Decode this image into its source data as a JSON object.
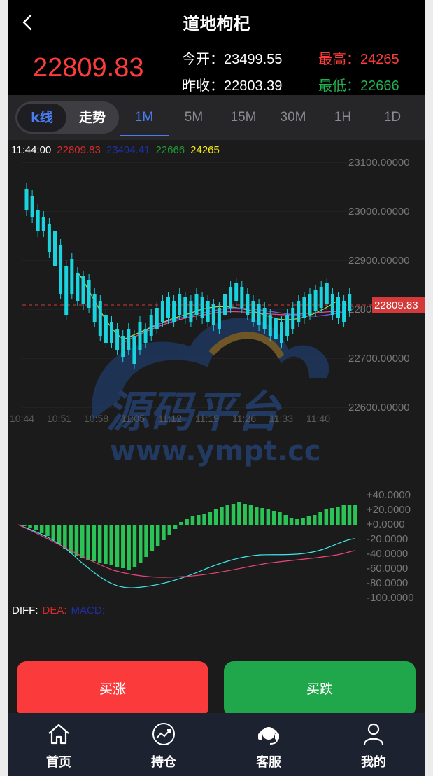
{
  "header": {
    "title": "道地枸杞",
    "current_price": "22809.83",
    "open_label": "今开：",
    "open_value": "23499.55",
    "prev_close_label": "昨收：",
    "prev_close_value": "22803.39",
    "high_label": "最高：",
    "high_value": "24265",
    "low_label": "最低：",
    "low_value": "22666"
  },
  "chart_type_tabs": [
    {
      "label": "k线",
      "active": true
    },
    {
      "label": "走势",
      "active": false
    }
  ],
  "timeframe_tabs": [
    {
      "label": "1M",
      "active": true
    },
    {
      "label": "5M",
      "active": false
    },
    {
      "label": "15M",
      "active": false
    },
    {
      "label": "30M",
      "active": false
    },
    {
      "label": "1H",
      "active": false
    },
    {
      "label": "1D",
      "active": false
    }
  ],
  "info_line": {
    "time": "11:44:00",
    "close": "22809.83",
    "open": "23494.41",
    "low": "22666",
    "high": "24265"
  },
  "price_axis_labels": [
    "23100.00000",
    "23000.00000",
    "22900.00000",
    "2280",
    "22700.00000",
    "22600.00000"
  ],
  "price_marker": "22809.83",
  "time_axis_labels": [
    "10:44",
    "10:51",
    "10:58",
    "11:05",
    "11:12",
    "11:19",
    "11:26",
    "11:33",
    "11:40"
  ],
  "watermark": {
    "text": "源码平台",
    "url": "www.ympt.cc"
  },
  "macd_axis_labels": [
    "+40.0000",
    "+20.0000",
    "+0.0000",
    "-20.0000",
    "-40.0000",
    "-60.0000",
    "-80.0000",
    "-100.0000"
  ],
  "macd_labels": {
    "diff": "DIFF:",
    "dea": "DEA:",
    "macd": "MACD:"
  },
  "colors": {
    "up": "#ff3c3c",
    "down": "#21b04d",
    "accent": "#4a7cf2",
    "candle": "#19d3de",
    "macd_bar": "#2bc256",
    "diff_line": "#3fe8ec",
    "dea_line": "#e8457a"
  },
  "actions": {
    "buy_up": "买涨",
    "buy_down": "买跌"
  },
  "bottom_nav": [
    {
      "label": "首页",
      "icon": "home-icon"
    },
    {
      "label": "持仓",
      "icon": "chart-icon"
    },
    {
      "label": "客服",
      "icon": "headset-icon"
    },
    {
      "label": "我的",
      "icon": "user-icon"
    }
  ]
}
